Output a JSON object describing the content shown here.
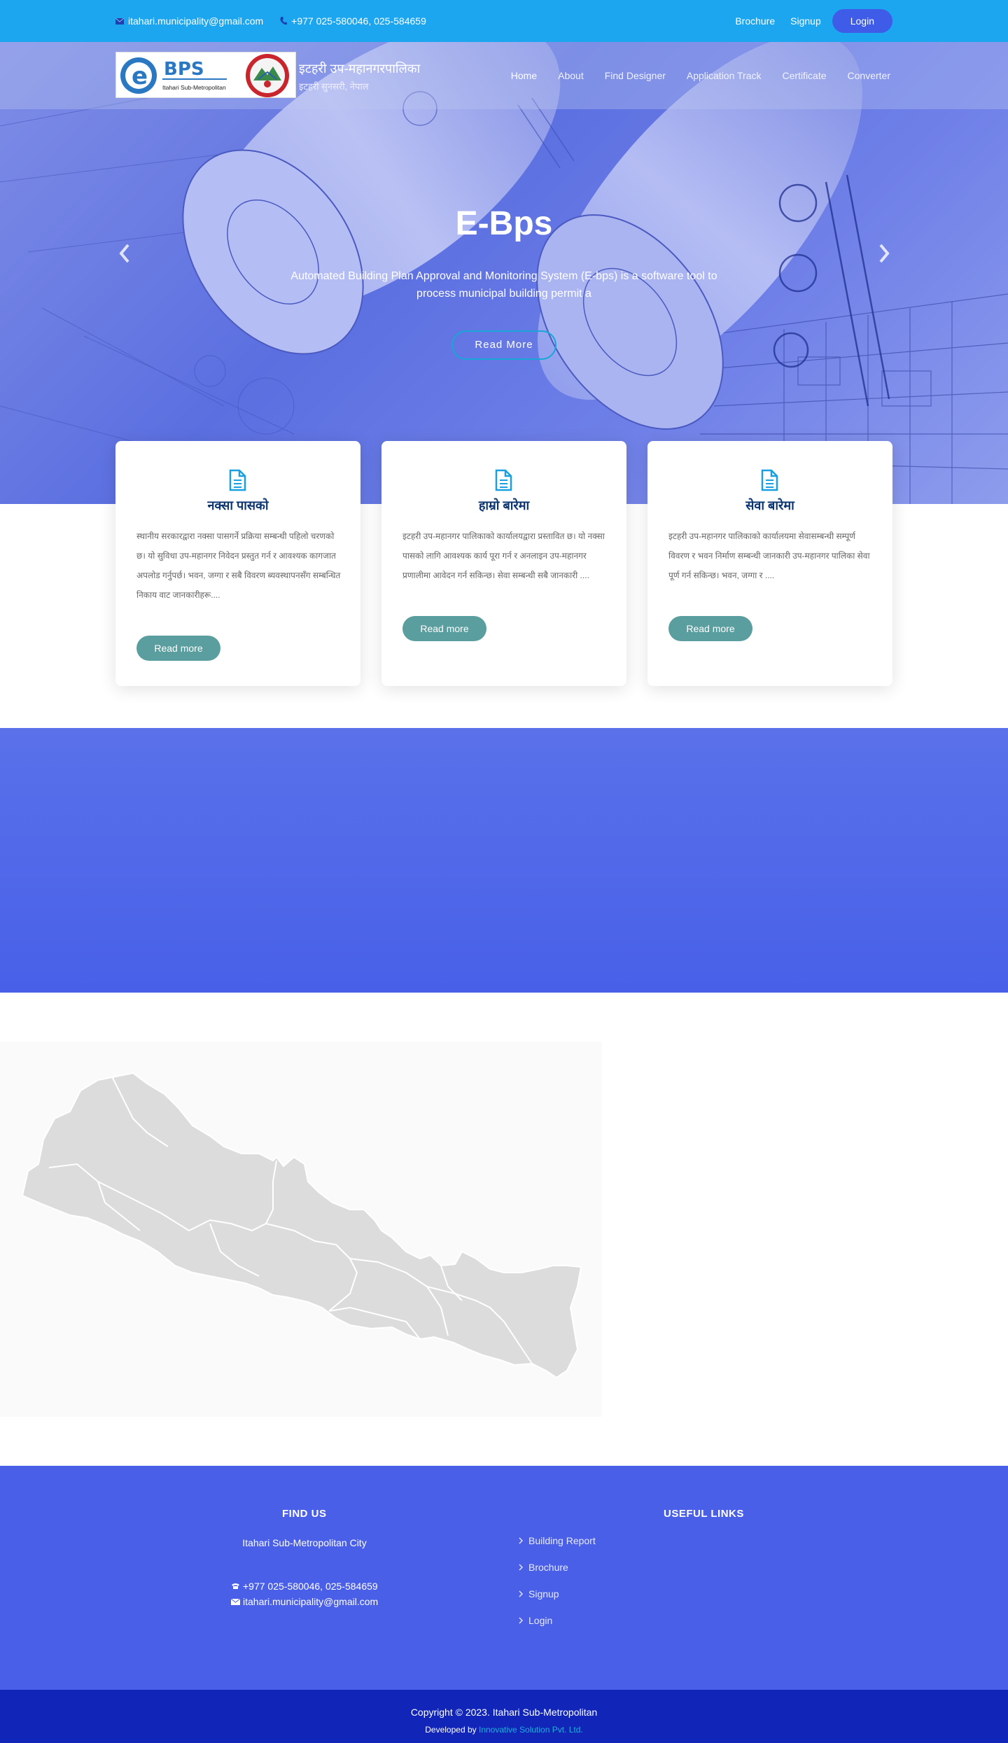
{
  "topbar": {
    "email": "itahari.municipality@gmail.com",
    "phone": "+977 025-580046, 025-584659",
    "links": [
      "Brochure",
      "Signup"
    ],
    "login_label": "Login"
  },
  "navbar": {
    "logo_text": "BPS",
    "logo_sub": "Itahari Sub-Metropolitan",
    "site_title": "इटहरी उप-महानगरपालिका",
    "site_subtitle": "इटहरी सुनसरी, नेपाल",
    "items": [
      "Home",
      "About",
      "Find Designer",
      "Application Track",
      "Certificate",
      "Converter"
    ]
  },
  "hero": {
    "title": "E-Bps",
    "description": "Automated Building Plan Approval and Monitoring System (E-bps) is a software tool to process municipal building permit a",
    "button_label": "Read More"
  },
  "cards": [
    {
      "title": "नक्सा पासको",
      "text": "स्थानीय सरकारद्वारा नक्सा पासगर्ने प्रक्रिया सम्बन्धी पहिलो चरणको छ। यो सुविधा उप-महानगर निवेदन प्रस्तुत गर्न र आवश्यक कागजात अपलोड गर्नुपर्छ। भवन, जग्गा र सबै विवरण ब्यवस्थापनसँग सम्बन्धित निकाय वाट जानकारीहरू....",
      "button_label": "Read more"
    },
    {
      "title": "हाम्रो बारेमा",
      "text": "इटहरी उप-महानगर पालिकाको कार्यालयद्वारा प्रस्तावित छ। यो नक्सा पासको लागि आवश्यक कार्य पूरा गर्न र अनलाइन उप-महानगर प्रणालीमा आवेदन गर्न सकिन्छ। सेवा सम्बन्धी सबै जानकारी ....",
      "button_label": "Read more"
    },
    {
      "title": "सेवा बारेमा",
      "text": "इटहरी उप-महानगर पालिकाको कार्यालयमा सेवासम्बन्धी सम्पूर्ण विवरण र भवन निर्माण सम्बन्धी जानकारी उप-महानगर पालिका सेवा पूर्ण गर्न सकिन्छ। भवन, जग्गा र ....",
      "button_label": "Read more"
    }
  ],
  "footer": {
    "find_us_title": "FIND US",
    "city": "Itahari Sub-Metropolitan City",
    "phone": "+977 025-580046, 025-584659",
    "email": "itahari.municipality@gmail.com",
    "useful_links_title": "USEFUL LINKS",
    "links": [
      "Building Report",
      "Brochure",
      "Signup",
      "Login"
    ],
    "copyright": "Copyright © 2023. Itahari Sub-Metropolitan",
    "developed_by": "Developed by",
    "company": "Innovative Solution Pvt. Ltd."
  },
  "colors": {
    "topbar": "#1ca6f0",
    "accent": "#3e5ce8",
    "band": "#4860e8",
    "footer": "#4a5fe8",
    "bottom": "#1126b8",
    "card_button": "#5b9ea0"
  }
}
